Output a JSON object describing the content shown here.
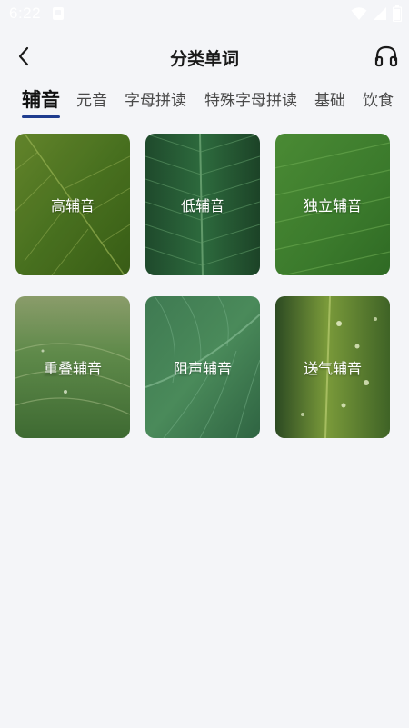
{
  "status_bar": {
    "time": "6:22"
  },
  "header": {
    "title": "分类单词"
  },
  "tabs": [
    {
      "label": "辅音",
      "active": true
    },
    {
      "label": "元音"
    },
    {
      "label": "字母拼读"
    },
    {
      "label": "特殊字母拼读"
    },
    {
      "label": "基础"
    },
    {
      "label": "饮食"
    }
  ],
  "cards": [
    {
      "label": "高辅音"
    },
    {
      "label": "低辅音"
    },
    {
      "label": "独立辅音"
    },
    {
      "label": "重叠辅音"
    },
    {
      "label": "阻声辅音"
    },
    {
      "label": "送气辅音"
    }
  ],
  "colors": {
    "background": "#f4f5f8",
    "tab_indicator": "#1f3c8f",
    "title_text": "#1a1a1a"
  }
}
